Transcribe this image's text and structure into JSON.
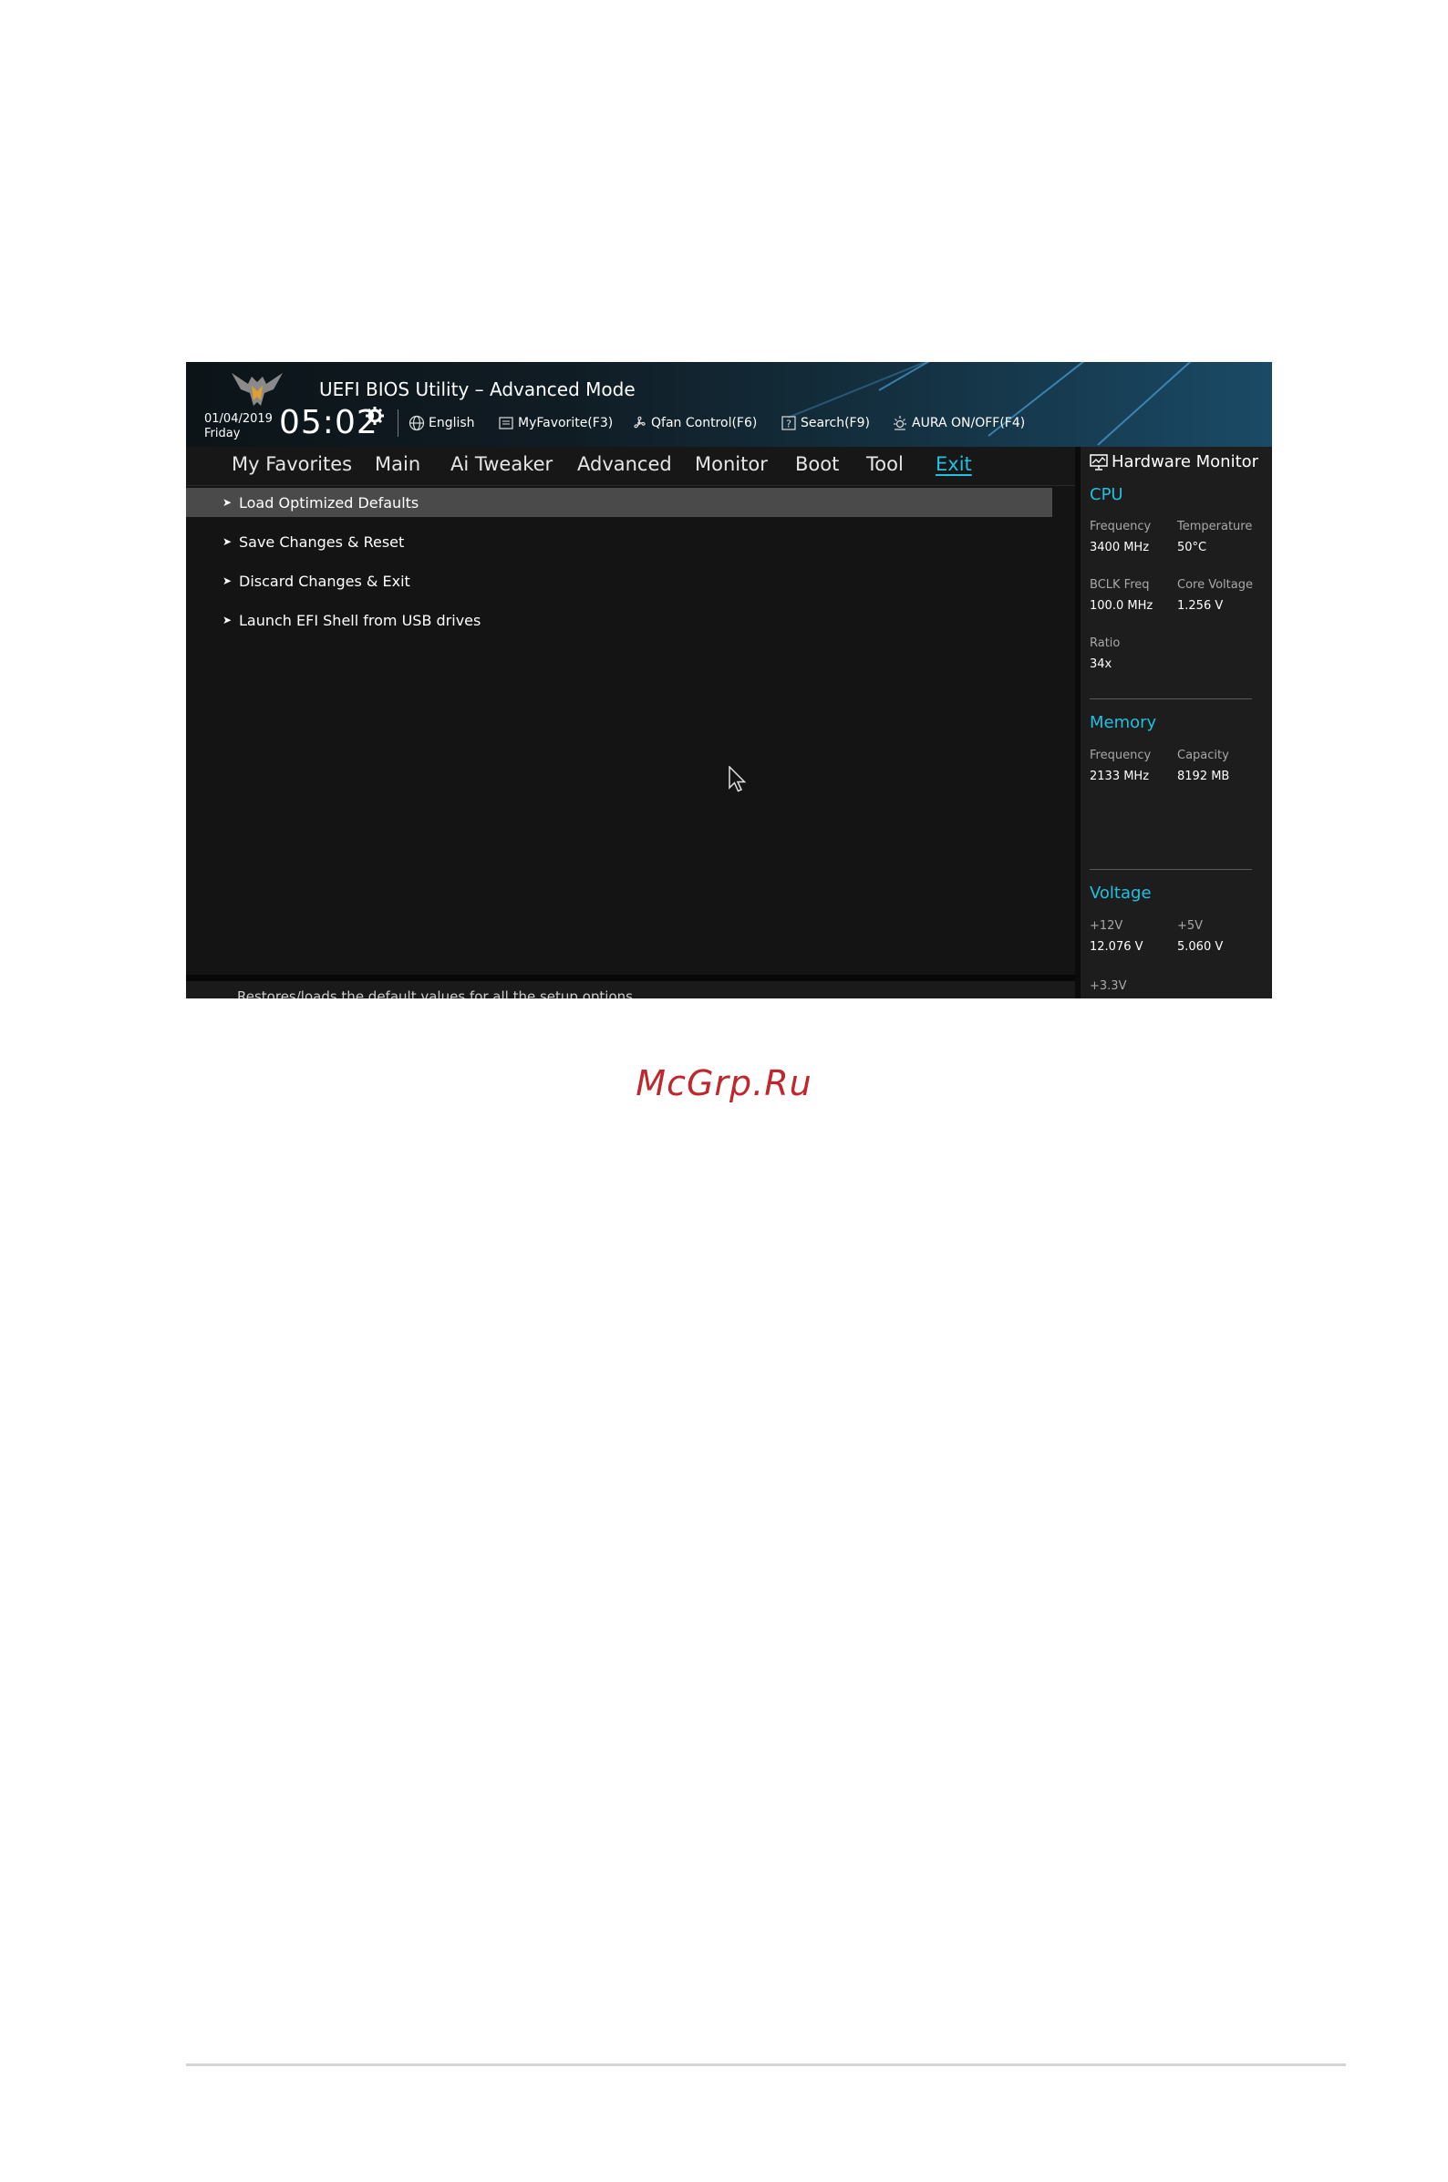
{
  "bios": {
    "title": "UEFI BIOS Utility – Advanced Mode",
    "date": "01/04/2019",
    "day": "Friday",
    "time": "05:02",
    "toolbar": [
      {
        "label": "English",
        "icon": "globe-icon"
      },
      {
        "label": "MyFavorite(F3)",
        "icon": "favorite-icon"
      },
      {
        "label": "Qfan Control(F6)",
        "icon": "fan-icon"
      },
      {
        "label": "Search(F9)",
        "icon": "search-help-icon"
      },
      {
        "label": "AURA ON/OFF(F4)",
        "icon": "aura-icon"
      }
    ],
    "tabs": [
      "My Favorites",
      "Main",
      "Ai Tweaker",
      "Advanced",
      "Monitor",
      "Boot",
      "Tool",
      "Exit"
    ],
    "active_tab": "Exit",
    "menu_items": [
      "Load Optimized Defaults",
      "Save Changes & Reset",
      "Discard Changes & Exit",
      "Launch EFI Shell from USB drives"
    ],
    "selected_item": "Load Optimized Defaults",
    "description": "Restores/loads the default values for all the setup options."
  },
  "hardware_monitor": {
    "title": "Hardware Monitor",
    "cpu": {
      "heading": "CPU",
      "frequency_label": "Frequency",
      "frequency": "3400 MHz",
      "temperature_label": "Temperature",
      "temperature": "50°C",
      "bclk_label": "BCLK Freq",
      "bclk": "100.0 MHz",
      "core_voltage_label": "Core Voltage",
      "core_voltage": "1.256 V",
      "ratio_label": "Ratio",
      "ratio": "34x"
    },
    "memory": {
      "heading": "Memory",
      "frequency_label": "Frequency",
      "frequency": "2133 MHz",
      "capacity_label": "Capacity",
      "capacity": "8192 MB"
    },
    "voltage": {
      "heading": "Voltage",
      "v12_label": "+12V",
      "v12": "12.076 V",
      "v5_label": "+5V",
      "v5": "5.060 V",
      "v33_label": "+3.3V"
    }
  },
  "watermark": "McGrp.Ru",
  "colors": {
    "accent": "#22c0e0",
    "background": "#141414",
    "selected": "#4a4a4a",
    "watermark": "#c0272d"
  }
}
